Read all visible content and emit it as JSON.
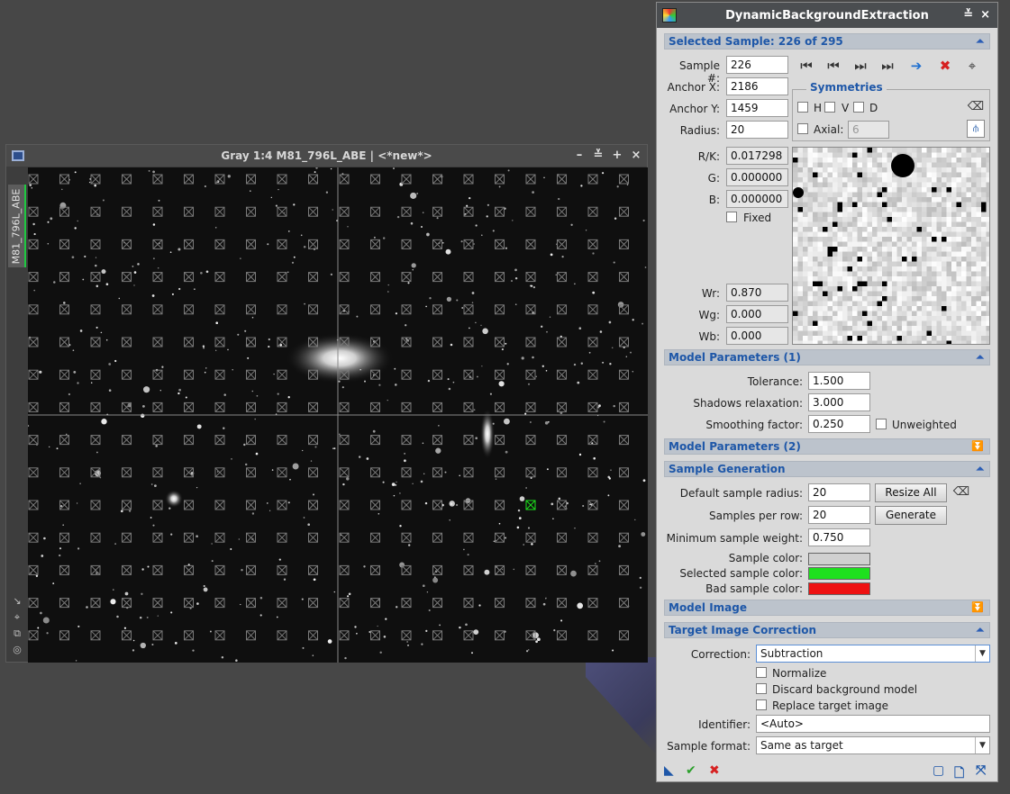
{
  "image_window": {
    "title": "Gray 1:4 M81_796L_ABE | <*new*>",
    "side_tab": "M81_796L_ABE",
    "controls": [
      "–",
      "≚",
      "+",
      "×"
    ],
    "side_tools": [
      "↘",
      "⌖",
      "⧉",
      "◎"
    ]
  },
  "dbe": {
    "title": "DynamicBackgroundExtraction",
    "title_controls": [
      "≚",
      "×"
    ],
    "selected_sample": {
      "header": "Selected Sample: 226 of 295",
      "sample_num_label": "Sample #:",
      "sample_num": "226",
      "anchor_x_label": "Anchor X:",
      "anchor_x": "2186",
      "anchor_y_label": "Anchor Y:",
      "anchor_y": "1459",
      "radius_label": "Radius:",
      "radius": "20",
      "rk_label": "R/K:",
      "rk": "0.017298",
      "g_label": "G:",
      "g": "0.000000",
      "b_label": "B:",
      "b": "0.000000",
      "fixed_label": "Fixed",
      "wr_label": "Wr:",
      "wr": "0.870",
      "wg_label": "Wg:",
      "wg": "0.000",
      "wb_label": "Wb:",
      "wb": "0.000",
      "symmetries_title": "Symmetries",
      "sym_h": "H",
      "sym_v": "V",
      "sym_d": "D",
      "axial_label": "Axial:",
      "axial_value": "6"
    },
    "model_params_1": {
      "header": "Model Parameters (1)",
      "tolerance_label": "Tolerance:",
      "tolerance": "1.500",
      "shadows_label": "Shadows relaxation:",
      "shadows": "3.000",
      "smoothing_label": "Smoothing factor:",
      "smoothing": "0.250",
      "unweighted_label": "Unweighted"
    },
    "model_params_2": {
      "header": "Model Parameters (2)"
    },
    "sample_generation": {
      "header": "Sample Generation",
      "default_radius_label": "Default sample radius:",
      "default_radius": "20",
      "resize_all": "Resize All",
      "per_row_label": "Samples per row:",
      "per_row": "20",
      "generate": "Generate",
      "min_weight_label": "Minimum sample weight:",
      "min_weight": "0.750",
      "sample_color_label": "Sample color:",
      "sample_color": "#d0d0d0",
      "selected_color_label": "Selected sample color:",
      "selected_color": "#1ee01e",
      "bad_color_label": "Bad sample color:",
      "bad_color": "#ee1111"
    },
    "model_image": {
      "header": "Model Image"
    },
    "target_correction": {
      "header": "Target Image Correction",
      "correction_label": "Correction:",
      "correction": "Subtraction",
      "normalize": "Normalize",
      "discard": "Discard background model",
      "replace": "Replace target image",
      "identifier_label": "Identifier:",
      "identifier": "<Auto>",
      "format_label": "Sample format:",
      "format": "Same as target"
    },
    "icons": {
      "first": "⏮",
      "prev": "⏮",
      "next": "⏭",
      "last": "⏭",
      "goto": "➔",
      "delete": "✖",
      "crosshair": "⌖",
      "clear_sym": "⌫",
      "expand": "⏶",
      "collapse": "⏬"
    }
  }
}
